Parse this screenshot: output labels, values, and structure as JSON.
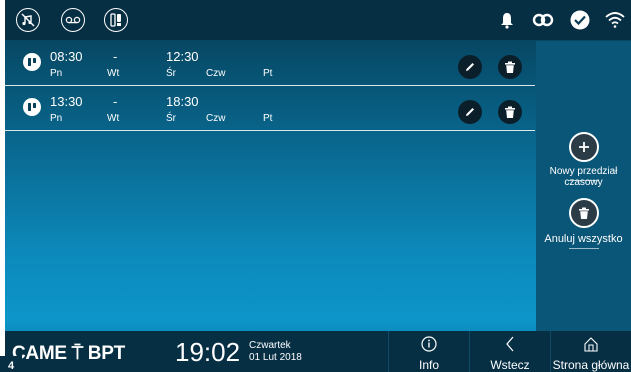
{
  "rows": [
    {
      "start": "08:30",
      "sep": "-",
      "end": "12:30",
      "days": [
        "Pn",
        "Wt",
        "Śr",
        "Czw",
        "Pt"
      ]
    },
    {
      "start": "13:30",
      "sep": "-",
      "end": "18:30",
      "days": [
        "Pn",
        "Wt",
        "Śr",
        "Czw",
        "Pt"
      ]
    }
  ],
  "side": {
    "add_label": "Nowy przedział czasowy",
    "cancel_label": "Anuluj wszystko"
  },
  "footer": {
    "logo": "CAME ⍑ BPT",
    "time": "19:02",
    "day": "Czwartek",
    "date": "01 Lut 2018",
    "info_label": "Info",
    "back_label": "Wstecz",
    "home_label": "Strona główna"
  },
  "page_number": "4",
  "icons": {
    "top_left": [
      "mute-icon",
      "voicemail-icon",
      "intercom-icon"
    ],
    "top_right": [
      "bell-icon",
      "link-icon",
      "check-icon",
      "wifi-icon"
    ]
  }
}
